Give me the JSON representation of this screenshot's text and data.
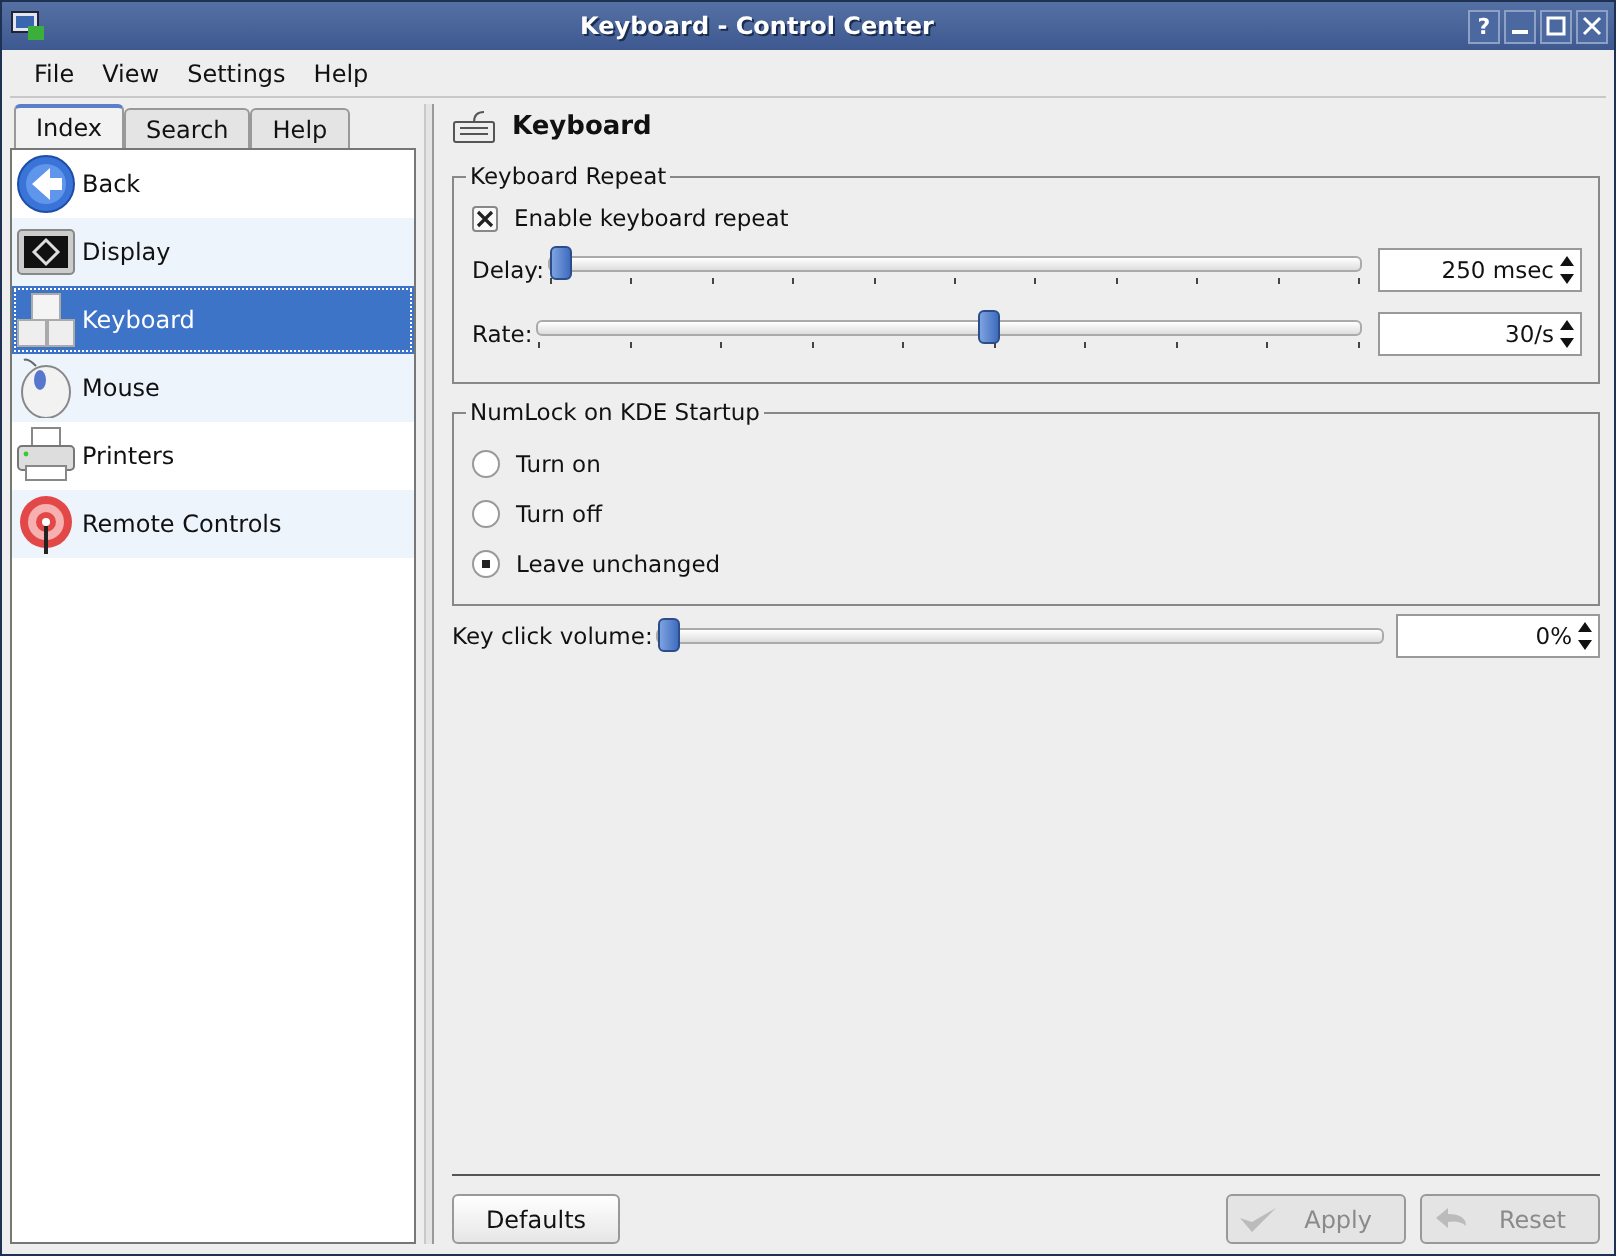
{
  "window": {
    "title": "Keyboard - Control Center",
    "buttons": [
      "?"
    ]
  },
  "menu": [
    "File",
    "View",
    "Settings",
    "Help"
  ],
  "tabs": [
    {
      "label": "Index",
      "selected": true
    },
    {
      "label": "Search",
      "selected": false
    },
    {
      "label": "Help",
      "selected": false
    }
  ],
  "sidebar": {
    "items": [
      {
        "label": "Back",
        "selected": false
      },
      {
        "label": "Display",
        "selected": false
      },
      {
        "label": "Keyboard",
        "selected": true
      },
      {
        "label": "Mouse",
        "selected": false
      },
      {
        "label": "Printers",
        "selected": false
      },
      {
        "label": "Remote Controls",
        "selected": false
      }
    ]
  },
  "page_title": "Keyboard",
  "keyboard_repeat": {
    "title": "Keyboard Repeat",
    "enable": {
      "label": "Enable keyboard repeat",
      "checked": true
    },
    "sliders": [
      {
        "label": "Delay:",
        "level": 0,
        "value": "250 msec"
      },
      {
        "label": "Rate:",
        "level": 0.55,
        "value": "30/s"
      }
    ]
  },
  "numlock": {
    "title": "NumLock on KDE Startup",
    "options": [
      {
        "label": "Turn on",
        "selected": false
      },
      {
        "label": "Turn off",
        "selected": false
      },
      {
        "label": "Leave unchanged",
        "selected": true
      }
    ]
  },
  "key_click": {
    "label": "Key click volume:",
    "level": 0,
    "value": "0%"
  },
  "buttons": [
    {
      "label": "Defaults",
      "disabled": false
    },
    {
      "label": "Apply",
      "disabled": true
    },
    {
      "label": "Reset",
      "disabled": true
    }
  ]
}
